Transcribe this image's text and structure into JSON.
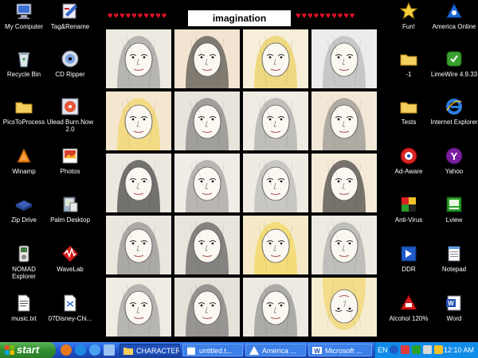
{
  "gallery": {
    "title": "imagination",
    "hearts_left": "♥♥♥♥♥♥♥♥♥♥",
    "hearts_right": "♥♥♥♥♥♥♥♥♥♥"
  },
  "desktop_icons_left": [
    {
      "label": "My Computer",
      "icon": "computer-icon"
    },
    {
      "label": "Tag&Rename",
      "icon": "tag-rename-icon"
    },
    {
      "label": "Recycle Bin",
      "icon": "recycle-bin-icon"
    },
    {
      "label": "CD Ripper",
      "icon": "cd-ripper-icon"
    },
    {
      "label": "PicsToProcess",
      "icon": "folder-icon"
    },
    {
      "label": "Ulead Burn.Now 2.0",
      "icon": "burn-disc-icon"
    },
    {
      "label": "Winamp",
      "icon": "winamp-icon"
    },
    {
      "label": "Photos",
      "icon": "photos-icon"
    },
    {
      "label": "Zip Drive",
      "icon": "zip-drive-icon"
    },
    {
      "label": "Palm Desktop",
      "icon": "palm-desktop-icon"
    },
    {
      "label": "NOMAD Explorer",
      "icon": "nomad-explorer-icon"
    },
    {
      "label": "WaveLab",
      "icon": "wavelab-icon"
    },
    {
      "label": "music.txt",
      "icon": "text-file-icon"
    },
    {
      "label": "07Disney-Chi...",
      "icon": "document-icon"
    }
  ],
  "desktop_icons_right": [
    {
      "label": "Fun!",
      "icon": "star-icon"
    },
    {
      "label": "America Online",
      "icon": "aol-icon"
    },
    {
      "label": "-1",
      "icon": "folder-icon"
    },
    {
      "label": "LimeWire 4.9.33",
      "icon": "limewire-icon"
    },
    {
      "label": "Tests",
      "icon": "folder-icon"
    },
    {
      "label": "Internet Explorer",
      "icon": "internet-explorer-icon"
    },
    {
      "label": "Ad-Aware",
      "icon": "ad-aware-icon"
    },
    {
      "label": "Yahoo",
      "icon": "yahoo-icon"
    },
    {
      "label": "Anti-Virus",
      "icon": "antivirus-icon"
    },
    {
      "label": "Lview",
      "icon": "lview-icon"
    },
    {
      "label": "DDR",
      "icon": "ddr-icon"
    },
    {
      "label": "Notepad",
      "icon": "notepad-icon"
    },
    {
      "label": "Alcohol 120%",
      "icon": "alcohol-icon"
    },
    {
      "label": "Word",
      "icon": "word-icon"
    }
  ],
  "drawings": [
    {
      "subject": "frowning-face-drawing"
    },
    {
      "subject": "woman-arms-out-drawing"
    },
    {
      "subject": "blonde-woman-drawing"
    },
    {
      "subject": "bald-face-drawing"
    },
    {
      "subject": "blonde-elf-drawing"
    },
    {
      "subject": "long-hair-portrait-drawing"
    },
    {
      "subject": "smiling-girl-drawing"
    },
    {
      "subject": "pigtail-girl-drawing"
    },
    {
      "subject": "dark-hair-goblet-drawing"
    },
    {
      "subject": "curly-hair-figure-drawing"
    },
    {
      "subject": "reclining-figure-drawing"
    },
    {
      "subject": "black-hair-girl-drawing"
    },
    {
      "subject": "closeup-face-drawing"
    },
    {
      "subject": "bangs-girl-drawing"
    },
    {
      "subject": "yellow-curly-hair-drawing"
    },
    {
      "subject": "hands-sketch-drawing"
    },
    {
      "subject": "wavy-hair-face-drawing"
    },
    {
      "subject": "hatched-face-drawing"
    },
    {
      "subject": "curtain-hair-face-drawing"
    },
    {
      "subject": "upside-down-blonde-drawing"
    }
  ],
  "taskbar": {
    "start_label": "start",
    "buttons": [
      {
        "label": "CHARACTER",
        "icon": "folder-icon",
        "active": true
      },
      {
        "label": "untitled.t...",
        "icon": "notepad-icon",
        "active": false
      },
      {
        "label": "America ...",
        "icon": "aol-icon",
        "active": false
      },
      {
        "label": "Microsoft ...",
        "icon": "word-icon",
        "active": false
      }
    ],
    "language": "EN",
    "clock": "12:10 AM"
  },
  "colors": {
    "taskbar": "#2157d6",
    "start_button": "#2f8f2f",
    "tray": "#0f8be8",
    "hearts": "#e8102a"
  }
}
